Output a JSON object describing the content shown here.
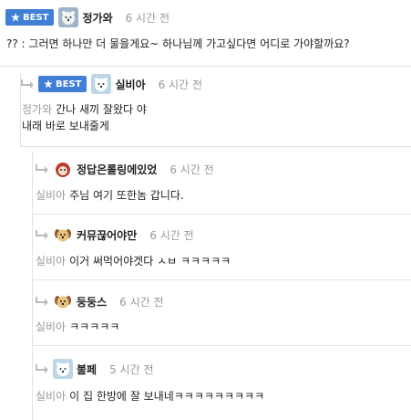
{
  "best_label": "BEST",
  "comments": [
    {
      "nick": "정가와",
      "time": "6 시간 전",
      "mention": "",
      "text": "?? : 그러면 하나만 더 물을게요~ 하나님께 가고싶다면 어디로 가야할까요?"
    },
    {
      "nick": "실비아",
      "time": "6 시간 전",
      "mention": "정가와",
      "text": "간나 새끼 잘왔다 야",
      "text2": "내래 바로 보내줄게"
    },
    {
      "nick": "정답은롤링에있었",
      "time": "6 시간 전",
      "mention": "실비아",
      "text": "주님 여기 또한놈 갑니다."
    },
    {
      "nick": "커뮤끊어야만",
      "time": "6 시간 전",
      "mention": "실비아",
      "text": "이거 써먹어야겟다 ㅅㅂ ㅋㅋㅋㅋㅋ"
    },
    {
      "nick": "둥둥스",
      "time": "6 시간 전",
      "mention": "실비아",
      "text": "ㅋㅋㅋㅋㅋ"
    },
    {
      "nick": "불페",
      "time": "5 시간 전",
      "mention": "실비아",
      "text": "이 집 한방에 잘 보내네ㅋㅋㅋㅋㅋㅋㅋㅋㅋ"
    }
  ]
}
